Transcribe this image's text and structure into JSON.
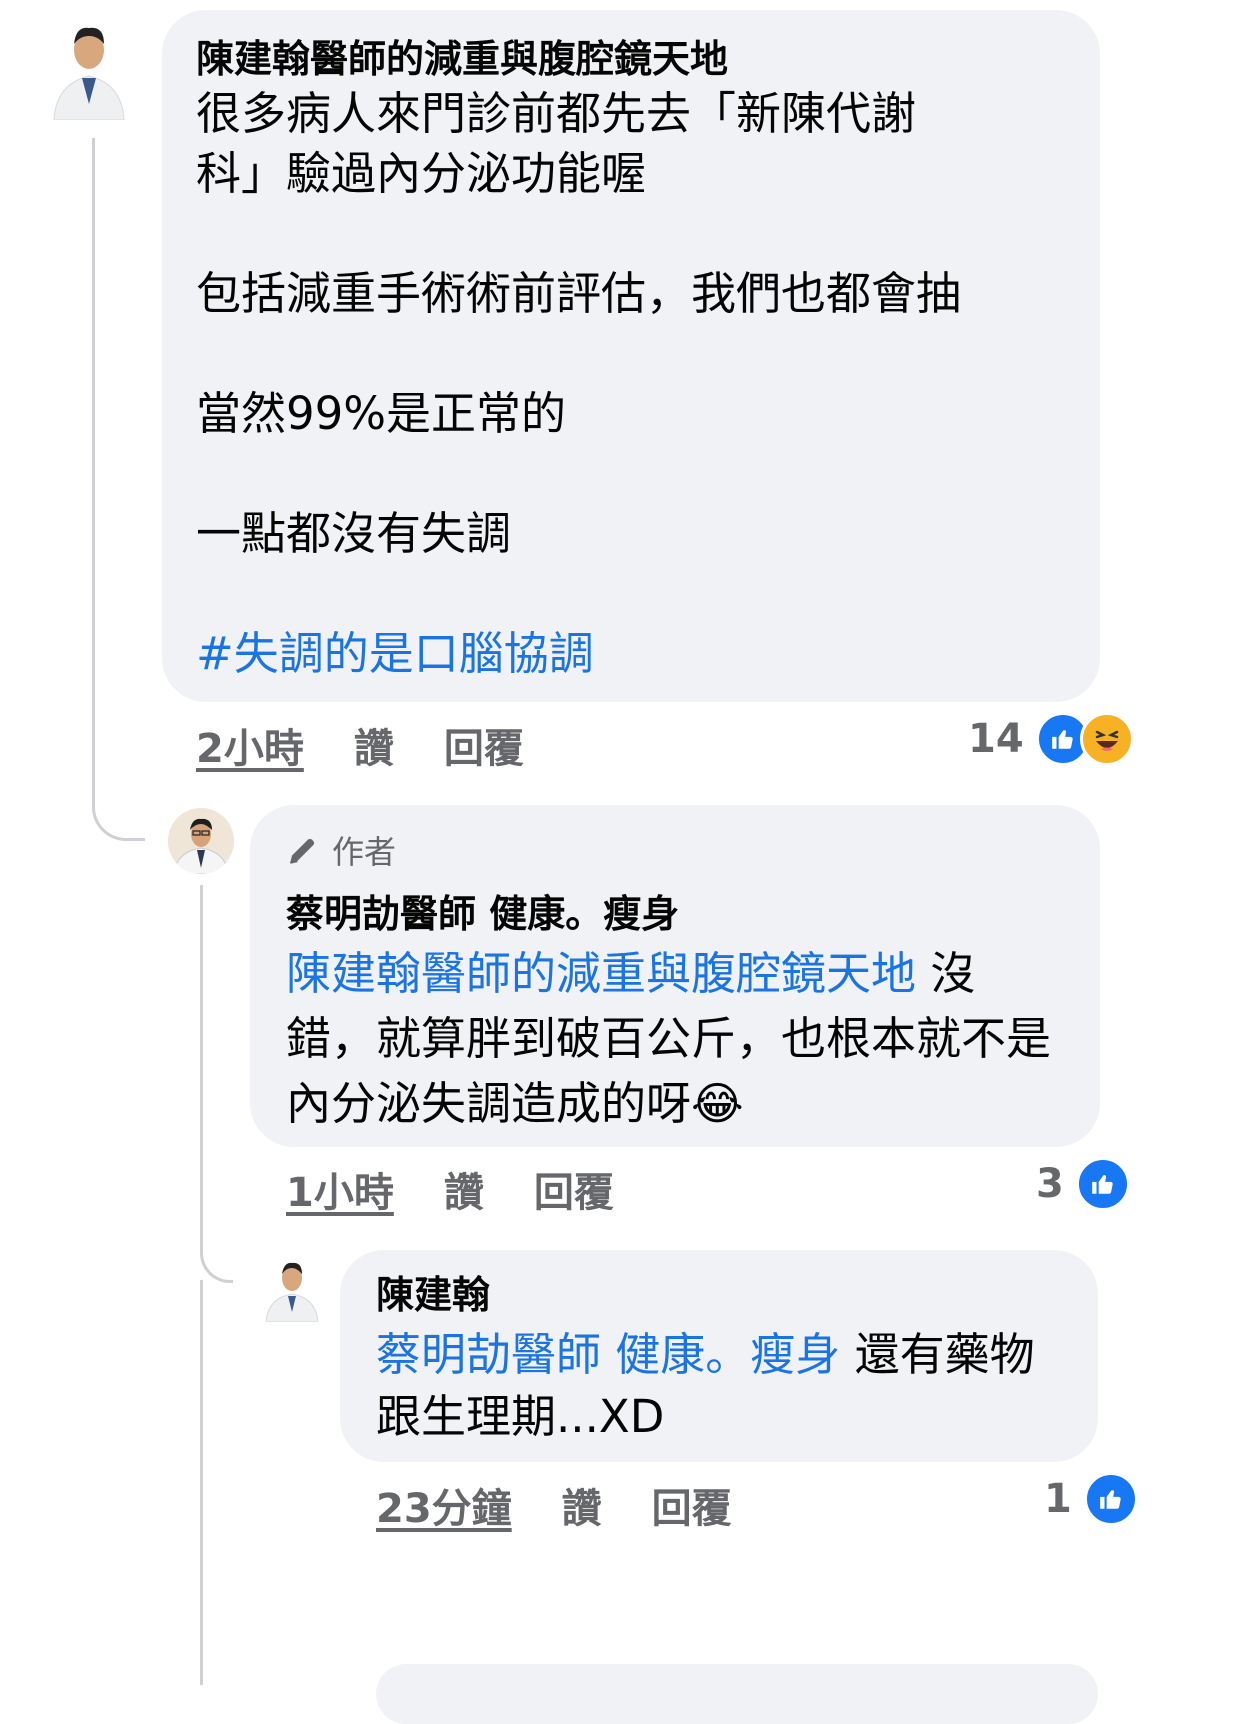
{
  "comment1": {
    "author": "陳建翰醫師的減重與腹腔鏡天地",
    "text_lines": [
      "很多病人來門診前都先去「新陳代謝",
      "科」驗過內分泌功能喔",
      "",
      "包括減重手術術前評估，我們也都會抽",
      "",
      "當然99%是正常的",
      "",
      "一點都沒有失調",
      ""
    ],
    "hashtag": "#失調的是口腦協調",
    "time": "2小時",
    "like_label": "讚",
    "reply_label": "回覆",
    "reaction_count": "14",
    "reaction_icons": [
      "like-icon",
      "haha-icon"
    ]
  },
  "reply1": {
    "badge_icon": "pencil-icon",
    "badge": "作者",
    "author": "蔡明劼醫師 健康。瘦身",
    "mention": "陳建翰醫師的減重與腹腔鏡天地",
    "text_after_mention": " 沒錯，就算胖到破百公斤，也根本就不是內分泌失調造成的呀",
    "emoji": "😂",
    "time": "1小時",
    "like_label": "讚",
    "reply_label": "回覆",
    "reaction_count": "3",
    "reaction_icons": [
      "like-icon"
    ]
  },
  "reply2": {
    "author": "陳建翰",
    "mention": "蔡明劼醫師 健康。瘦身",
    "text_after_mention": " 還有藥物跟生理期...XD",
    "time": "23分鐘",
    "like_label": "讚",
    "reply_label": "回覆",
    "reaction_count": "1",
    "reaction_icons": [
      "like-icon"
    ]
  },
  "colors": {
    "bubble": "#f0f2f5",
    "link": "#1b74e4",
    "like": "#1877f2",
    "haha": "#f7b125",
    "meta": "#65676b"
  }
}
